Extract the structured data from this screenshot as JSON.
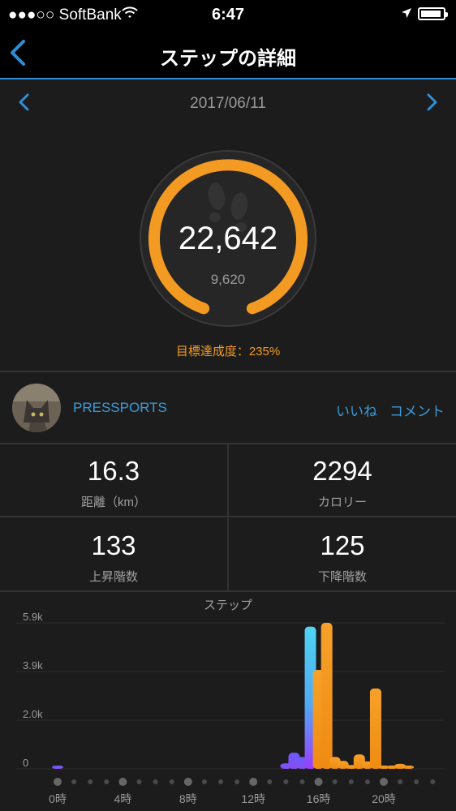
{
  "status_bar": {
    "carrier": "●●●○○ SoftBank",
    "time": "6:47"
  },
  "nav": {
    "title": "ステップの詳細"
  },
  "date": "2017/06/11",
  "summary": {
    "steps": "22,642",
    "goal": "9,620",
    "achievement": "目標達成度：235%",
    "achievement_percent": 235
  },
  "user": {
    "name": "PRESSPORTS",
    "like": "いいね",
    "comment": "コメント"
  },
  "stats": [
    {
      "value": "16.3",
      "label": "距離（km）"
    },
    {
      "value": "2294",
      "label": "カロリー"
    },
    {
      "value": "133",
      "label": "上昇階数"
    },
    {
      "value": "125",
      "label": "下降階数"
    }
  ],
  "colors": {
    "accent": "#f39a23",
    "link": "#3b9bdc",
    "purple": "#7a4cff",
    "cyan": "#4fd4f0",
    "background": "#1c1c1c"
  },
  "chart_data": {
    "type": "bar",
    "title": "ステップ",
    "ylim": [
      0,
      5900
    ],
    "ytick_labels": [
      "0",
      "2.0k",
      "3.9k",
      "5.9k"
    ],
    "ytick_values": [
      0,
      1967,
      3933,
      5900
    ],
    "xtick_labels": [
      "0時",
      "4時",
      "8時",
      "12時",
      "16時",
      "20時"
    ],
    "interval": "30 minutes",
    "values": [
      120,
      0,
      0,
      0,
      0,
      0,
      0,
      0,
      0,
      0,
      0,
      0,
      0,
      0,
      0,
      0,
      0,
      0,
      0,
      0,
      0,
      0,
      0,
      0,
      0,
      0,
      0,
      0,
      220,
      650,
      480,
      5750,
      4000,
      5900,
      480,
      320,
      150,
      580,
      300,
      3250,
      90,
      130,
      200,
      100,
      0,
      0,
      0,
      0
    ],
    "bar_color_types": [
      "purple",
      "purple",
      "purple",
      "purple",
      "purple",
      "purple",
      "purple",
      "purple",
      "purple",
      "purple",
      "purple",
      "purple",
      "purple",
      "purple",
      "purple",
      "purple",
      "purple",
      "purple",
      "purple",
      "purple",
      "purple",
      "purple",
      "purple",
      "purple",
      "purple",
      "purple",
      "purple",
      "purple",
      "purple",
      "purple",
      "purple",
      "gradient",
      "orange",
      "orange",
      "orange",
      "orange",
      "orange",
      "orange",
      "orange",
      "orange",
      "orange",
      "orange",
      "orange",
      "orange",
      "orange",
      "orange",
      "orange",
      "orange"
    ]
  }
}
